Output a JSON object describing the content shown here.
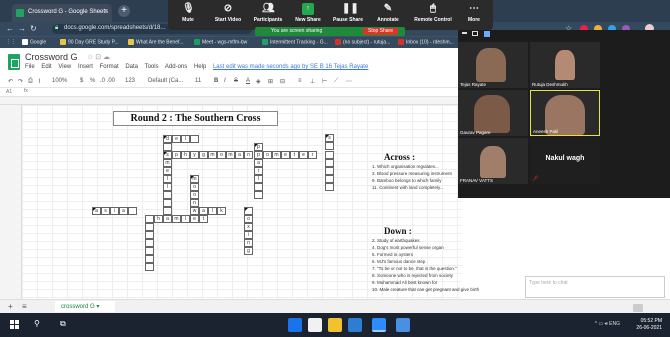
{
  "browser": {
    "tab_title": "Crossword G - Google Sheets",
    "tab_close": "×",
    "new_tab": "+",
    "url": "docs.google.com/spreadsheets/d/18...",
    "bookmarks": [
      "Google",
      "90 Day GRE Study P...",
      "What Are the Benef...",
      "Meet - wgs-mtfm-bw",
      "Intermittent Tracking - G...",
      "(no subject) - rutuja...",
      "Inbox (10) - rdeshm..."
    ]
  },
  "zoom_toolbar": {
    "items": [
      "Mute",
      "Start Video",
      "Participants",
      "New Share",
      "Pause Share",
      "Annotate",
      "Remote Control",
      "More"
    ],
    "sharing_banner": "You are screen sharing",
    "stop_share": "Stop Share"
  },
  "sheets": {
    "doc_title": "Crossword G",
    "menu": [
      "File",
      "Edit",
      "View",
      "Insert",
      "Format",
      "Data",
      "Tools",
      "Add-ons",
      "Help"
    ],
    "last_edit": "Last edit was made seconds ago by SE B 16 Tejas Rayate",
    "toolbar": {
      "zoom": "100%",
      "currency": "$",
      "percent": "%",
      "decimals": ".0 .00",
      "format": "123",
      "font": "Default (Ca...",
      "size": "11"
    },
    "cell_ref": "A1",
    "puzzle_title": "Round 2 : The Southern Cross",
    "across_head": "Across :",
    "across": [
      "1. Which organisation regulates...",
      "3. Blood pressure measuring instrument",
      "9. Bamboo belongs to which family",
      "11. Continent with land completely..."
    ],
    "down_head": "Down :",
    "down": [
      "2. Study of earthquakes",
      "4. Dog's most powerful sense organ",
      "5. Formed in oysters",
      "6. MJ's famous dance step",
      "7. \"To be or not to be, that is the question.\"",
      "8. Someone who is rejected from society",
      "9. Muhammad Ali best known for",
      "10. Male creature that can get pregnant and give birth"
    ],
    "sheet_tab": "crossword G"
  },
  "gallery": {
    "participants": [
      "Tejas Rayate",
      "Rutuja Deshmukh",
      "Gaurav Pagare",
      "Aneesh Patil",
      "FRANAV VATTS",
      "Nakul wagh"
    ],
    "chat_placeholder": "Type here to chat"
  },
  "taskbar": {
    "time": "05:52 PM",
    "date": "26-06-2021",
    "lang": "ENG"
  },
  "colors": {
    "sheets_green": "#1ea362",
    "zoom_green": "#22a84f",
    "stop_red": "#d9352b"
  }
}
